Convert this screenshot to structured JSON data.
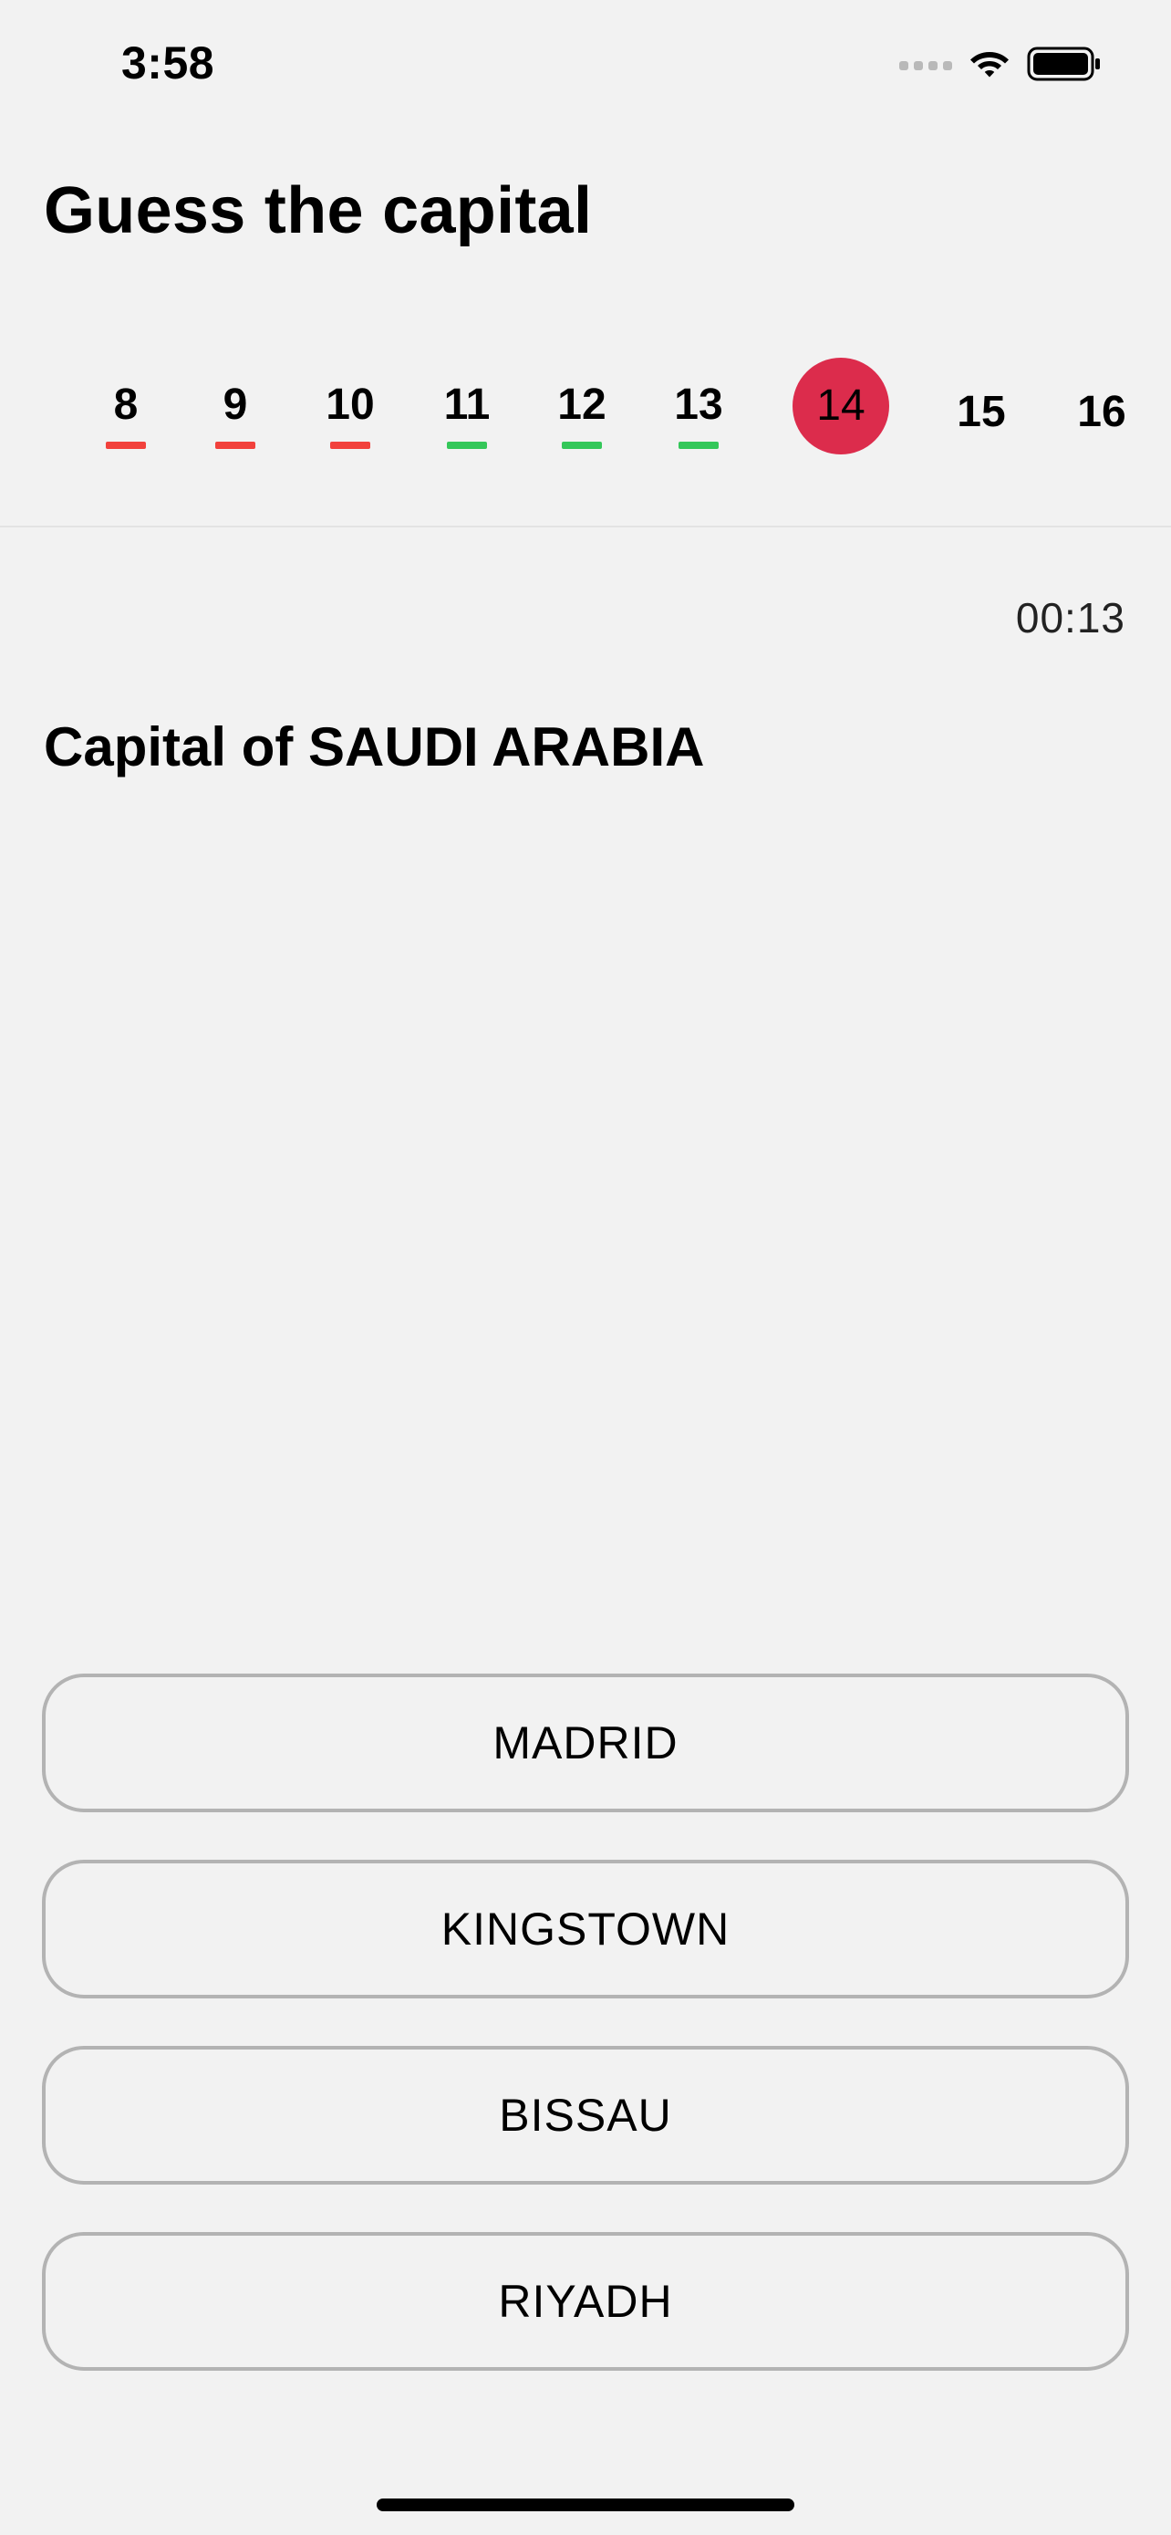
{
  "status_bar": {
    "time": "3:58"
  },
  "page": {
    "title": "Guess the capital"
  },
  "question_nav": {
    "items": [
      {
        "label": "8",
        "state": "wrong"
      },
      {
        "label": "9",
        "state": "wrong"
      },
      {
        "label": "10",
        "state": "wrong"
      },
      {
        "label": "11",
        "state": "correct"
      },
      {
        "label": "12",
        "state": "correct"
      },
      {
        "label": "13",
        "state": "correct"
      },
      {
        "label": "14",
        "state": "current"
      },
      {
        "label": "15",
        "state": "upcoming"
      },
      {
        "label": "16",
        "state": "upcoming"
      }
    ]
  },
  "timer": "00:13",
  "question": "Capital of SAUDI ARABIA",
  "answers": [
    "MADRID",
    "KINGSTOWN",
    "BISSAU",
    "RIYADH"
  ],
  "colors": {
    "wrong": "#f2413c",
    "correct": "#34c759",
    "current": "#dc2c4c",
    "background": "#f2f2f2",
    "button_border": "#b3b3b3"
  },
  "icons": {
    "signal": "cellular-signal-icon",
    "wifi": "wifi-icon",
    "battery": "battery-icon"
  }
}
